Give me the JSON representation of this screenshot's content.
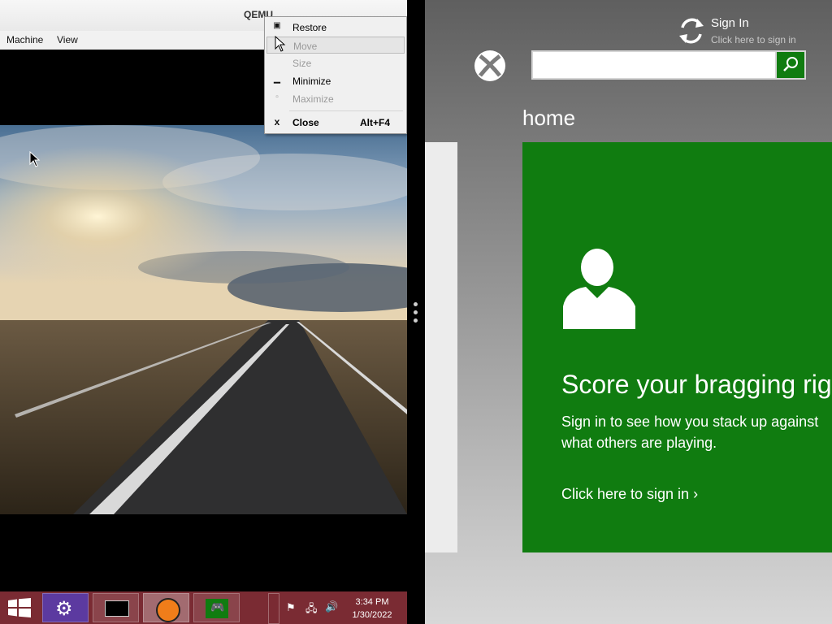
{
  "window": {
    "title": "QEMU",
    "menu": [
      "Machine",
      "View"
    ]
  },
  "context_menu": {
    "items": [
      {
        "label": "Restore",
        "icon": "restore-icon",
        "enabled": true,
        "highlighted": false,
        "accel": ""
      },
      {
        "label": "Move",
        "icon": "",
        "enabled": false,
        "highlighted": true,
        "accel": ""
      },
      {
        "label": "Size",
        "icon": "",
        "enabled": false,
        "highlighted": false,
        "accel": ""
      },
      {
        "label": "Minimize",
        "icon": "minimize-icon",
        "enabled": true,
        "highlighted": false,
        "accel": ""
      },
      {
        "label": "Maximize",
        "icon": "maximize-icon",
        "enabled": false,
        "highlighted": false,
        "accel": ""
      },
      {
        "label": "Close",
        "icon": "close-icon",
        "enabled": true,
        "highlighted": false,
        "accel": "Alt+F4"
      }
    ]
  },
  "taskbar": {
    "apps": [
      "start-icon",
      "settings-icon",
      "command-prompt-icon",
      "qemu-icon",
      "xbox-games-icon"
    ],
    "tray_icons": [
      "action-center-flag-icon",
      "network-icon",
      "volume-icon"
    ],
    "time": "3:34 PM",
    "date": "1/30/2022",
    "color": "#7a2b33"
  },
  "xbox": {
    "signin_title": "Sign In",
    "signin_subtitle": "Click here to sign in",
    "search_value": "",
    "section_title": "home",
    "tile": {
      "heading": "Score your bragging rig",
      "body_line1": "Sign in to see how you stack up against",
      "body_line2": "what others are playing.",
      "link": "Click here to sign in ›"
    },
    "accent": "#107c10"
  }
}
